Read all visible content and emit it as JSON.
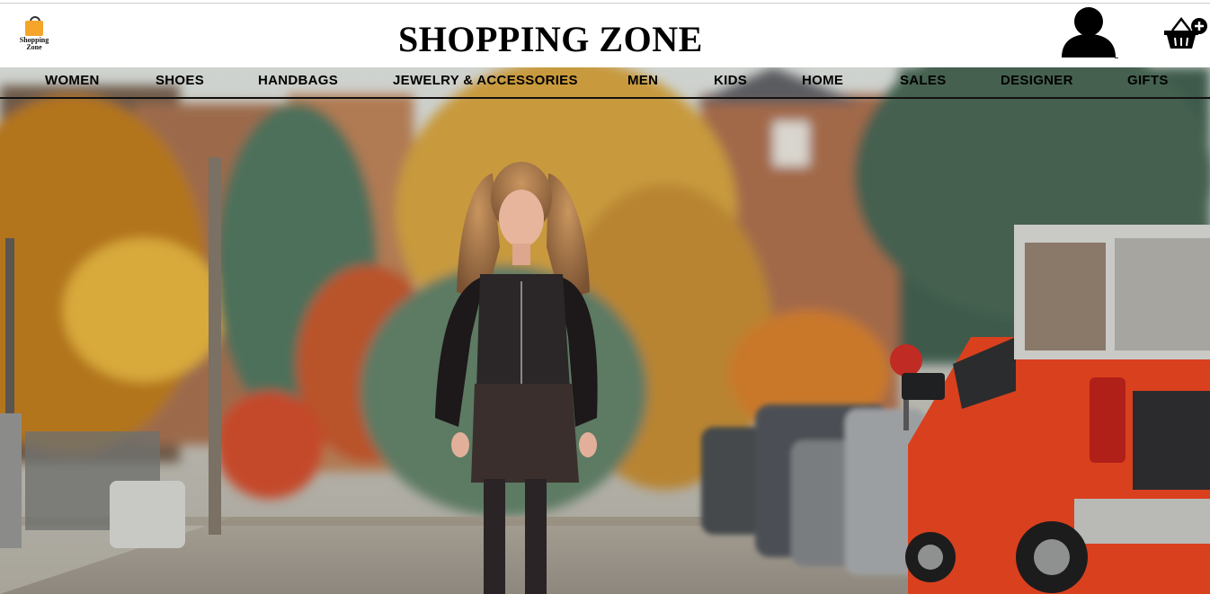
{
  "header": {
    "logo_text": "Shopping Zone",
    "title": "SHOPPING ZONE",
    "user_icon": "user-silhouette-icon",
    "cart_icon": "basket-add-icon"
  },
  "nav": {
    "items": [
      {
        "label": "WOMEN"
      },
      {
        "label": "SHOES"
      },
      {
        "label": "HANDBAGS"
      },
      {
        "label": "JEWELRY & ACCESSORIES"
      },
      {
        "label": "MEN"
      },
      {
        "label": "KIDS"
      },
      {
        "label": "HOME"
      },
      {
        "label": "SALES"
      },
      {
        "label": "DESIGNER"
      },
      {
        "label": "GIFTS"
      }
    ]
  },
  "hero": {
    "subject": "woman-walking-autumn-street",
    "colors": {
      "accent": "#f4a52a",
      "truck": "#d9401e",
      "foliage": "#c8782a"
    }
  }
}
